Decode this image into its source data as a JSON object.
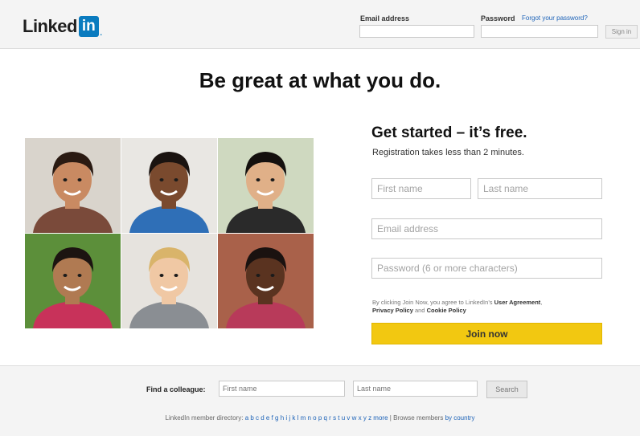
{
  "header": {
    "logo_text": "Linked",
    "logo_in": "in",
    "logo_dot": ".",
    "email_label": "Email address",
    "password_label": "Password",
    "forgot_link": "Forgot your password?",
    "sign_in": "Sign in"
  },
  "headline": "Be great at what you do.",
  "signup": {
    "title": "Get started – it’s free.",
    "subtitle": "Registration takes less than 2 minutes.",
    "first_name_placeholder": "First name",
    "last_name_placeholder": "Last name",
    "email_placeholder": "Email address",
    "password_placeholder": "Password (6 or more characters)",
    "terms_prefix": "By clicking Join Now, you agree to LinkedIn’s",
    "user_agreement": "User Agreement",
    "privacy_policy": "Privacy Policy",
    "terms_and": "and",
    "cookie_policy": "Cookie Policy",
    "join_button": "Join now"
  },
  "photos": [
    {
      "skin": "#c98a62",
      "hair": "#2a1a12",
      "shirt": "#7a4a3a",
      "bg": "#d9d4cc"
    },
    {
      "skin": "#7a4a2e",
      "hair": "#1a1310",
      "shirt": "#2f6fb7",
      "bg": "#e9e7e3"
    },
    {
      "skin": "#e0b088",
      "hair": "#14100e",
      "shirt": "#2a2a2a",
      "bg": "#cfd9c0"
    },
    {
      "skin": "#b07a52",
      "hair": "#1c1411",
      "shirt": "#c8325a",
      "bg": "#5c8f3a"
    },
    {
      "skin": "#f0c8a4",
      "hair": "#d9b46a",
      "shirt": "#8a8e93",
      "bg": "#e6e3de"
    },
    {
      "skin": "#5a3320",
      "hair": "#1a1210",
      "shirt": "#b83a5a",
      "bg": "#a9614a"
    }
  ],
  "footer": {
    "find_label": "Find a colleague:",
    "first_name_placeholder": "First name",
    "last_name_placeholder": "Last name",
    "search_button": "Search",
    "directory_prefix": "LinkedIn member directory:",
    "directory_letters": "a b c d e f g h i j k l m n o p q r s t u v w x y z more",
    "directory_sep": "|",
    "browse_prefix": "Browse members",
    "browse_link": "by country"
  }
}
